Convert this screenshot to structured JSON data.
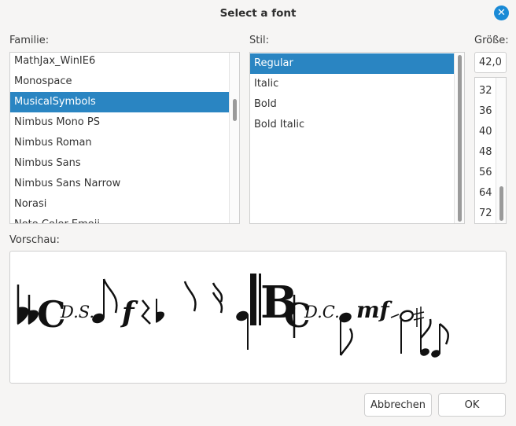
{
  "dialog": {
    "title": "Select a font"
  },
  "family": {
    "label": "Familie:",
    "items": [
      "MathJax_WinIE6",
      "Monospace",
      "MusicalSymbols",
      "Nimbus Mono PS",
      "Nimbus Roman",
      "Nimbus Sans",
      "Nimbus Sans Narrow",
      "Norasi",
      "Noto Color Emoji"
    ],
    "selected": "MusicalSymbols"
  },
  "style": {
    "label": "Stil:",
    "items": [
      "Regular",
      "Italic",
      "Bold",
      "Bold Italic"
    ],
    "selected": "Regular"
  },
  "size": {
    "label": "Größe:",
    "value": "42,0",
    "items": [
      "32",
      "36",
      "40",
      "48",
      "56",
      "64",
      "72"
    ]
  },
  "preview": {
    "label": "Vorschau:",
    "text_ds": "D.S.",
    "text_dc": "D.C.",
    "text_mf": "mf"
  },
  "buttons": {
    "cancel": "Abbrechen",
    "ok": "OK"
  },
  "colors": {
    "accent": "#2a85c2",
    "close": "#1a8ad6"
  }
}
